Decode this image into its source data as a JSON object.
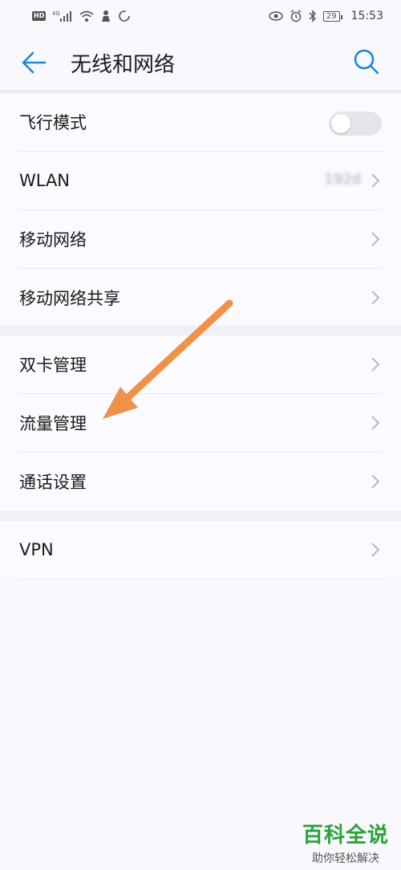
{
  "status_bar": {
    "hd": "HD",
    "network": "4G",
    "battery": "29",
    "time": "15:53"
  },
  "header": {
    "title": "无线和网络",
    "back_icon": "arrow-left-icon",
    "search_icon": "search-icon"
  },
  "sections": [
    {
      "items": [
        {
          "label": "飞行模式",
          "type": "toggle",
          "on": false
        },
        {
          "label": "WLAN",
          "type": "link",
          "value": "192d"
        },
        {
          "label": "移动网络",
          "type": "link"
        },
        {
          "label": "移动网络共享",
          "type": "link"
        }
      ]
    },
    {
      "items": [
        {
          "label": "双卡管理",
          "type": "link"
        },
        {
          "label": "流量管理",
          "type": "link"
        },
        {
          "label": "通话设置",
          "type": "link"
        }
      ]
    },
    {
      "items": [
        {
          "label": "VPN",
          "type": "link"
        }
      ]
    }
  ],
  "annotation": {
    "color": "#f0914a",
    "icon": "arrow-pointer-icon"
  },
  "watermark": {
    "title": "百科全说",
    "subtitle": "助你轻松解决",
    "color": "#28a33a"
  }
}
